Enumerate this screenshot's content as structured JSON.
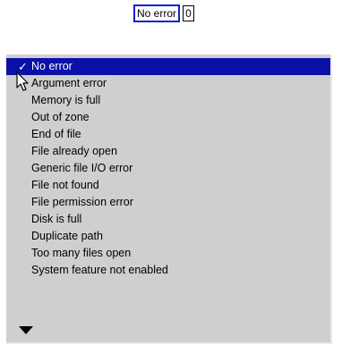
{
  "popup": {
    "selected_label": "No error",
    "value": "0"
  },
  "menu": {
    "check_glyph": "✓",
    "items": [
      {
        "label": "No error"
      },
      {
        "label": "Argument error"
      },
      {
        "label": "Memory is full"
      },
      {
        "label": "Out of zone"
      },
      {
        "label": "End of file"
      },
      {
        "label": "File already open"
      },
      {
        "label": "Generic file I/O error"
      },
      {
        "label": "File not found"
      },
      {
        "label": "File permission error"
      },
      {
        "label": "Disk is full"
      },
      {
        "label": "Duplicate path"
      },
      {
        "label": "Too many files open"
      },
      {
        "label": "System feature not enabled"
      }
    ],
    "selected_index": 0,
    "scroll_icon": "down-arrow-icon"
  },
  "colors": {
    "selection_bg": "#0a10a8",
    "menu_bg": "#cfcfcf",
    "trigger_border": "#1220d4"
  }
}
